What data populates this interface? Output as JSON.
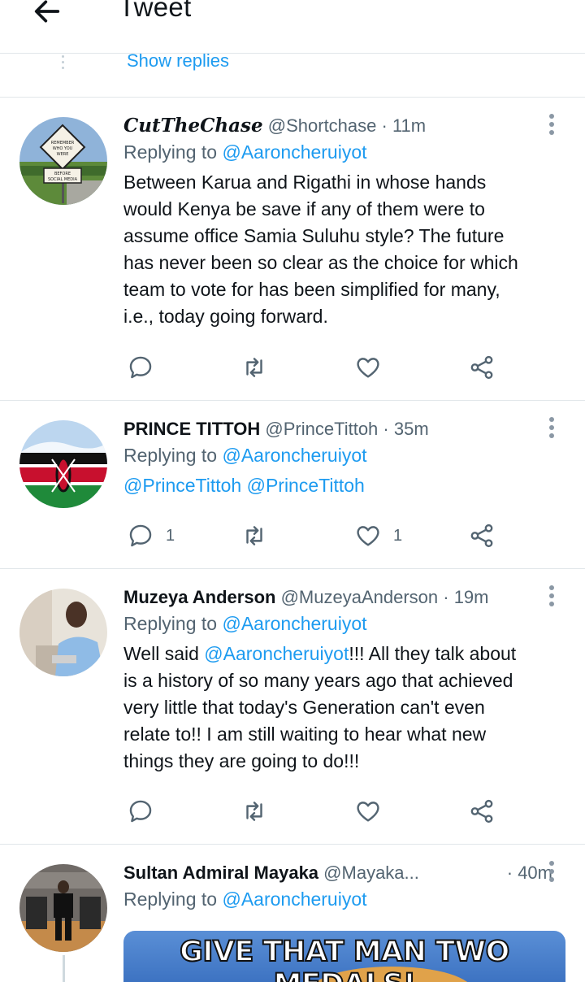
{
  "header": {
    "title": "Tweet",
    "back_icon": "arrow-left-icon"
  },
  "show_replies": {
    "label": "Show replies"
  },
  "tweets": [
    {
      "display_name": "CutTheChase",
      "handle": "@Shortchase",
      "time": "· 11m",
      "replying_prefix": "Replying to ",
      "replying_to": "@Aaroncheruiyot",
      "body_lines": [
        "Between Karua and Rigathi in whose hands",
        "would Kenya be save if any of them were to",
        "assume office Samia Suluhu style? The future",
        "has never been so clear as the choice for which",
        "team to vote for has been simplified for many,",
        "i.e., today going forward."
      ],
      "avatar_sign": [
        "REMEMBER",
        "WHO YOU",
        "WERE",
        "BEFORE",
        "SOCIAL MEDIA"
      ],
      "reply_count": "",
      "like_count": ""
    },
    {
      "display_name": "PRINCE TITTOH",
      "handle": "@PrinceTittoh",
      "time": "· 35m",
      "replying_prefix": "Replying to ",
      "replying_to": "@Aaroncheruiyot",
      "body_mentions": "@PrinceTittoh @PrinceTittoh",
      "reply_count": "1",
      "like_count": "1"
    },
    {
      "display_name": "Muzeya Anderson",
      "handle": "@MuzeyaAnderson",
      "time": "· 19m",
      "replying_prefix": "Replying to ",
      "replying_to": "@Aaroncheruiyot",
      "body_first_prefix": "Well said ",
      "body_first_mention": "@Aaroncheruiyot",
      "body_first_rest": "!!! All they talk about",
      "body_lines": [
        "is a history of so many years ago that achieved",
        "very little that today's Generation can't even",
        "relate to!! I am still waiting to hear what new",
        "things they are going to do!!!"
      ],
      "reply_count": "",
      "like_count": ""
    },
    {
      "display_name": "Sultan Admiral Mayaka",
      "handle": "@Mayaka...",
      "time": "· 40m",
      "replying_prefix": "Replying to ",
      "replying_to": "@Aaroncheruiyot",
      "media_text": "GIVE THAT MAN TWO MEDALS!"
    }
  ],
  "colors": {
    "link": "#1d9bf0",
    "secondary": "#536471",
    "divider": "#e1e6ea"
  }
}
